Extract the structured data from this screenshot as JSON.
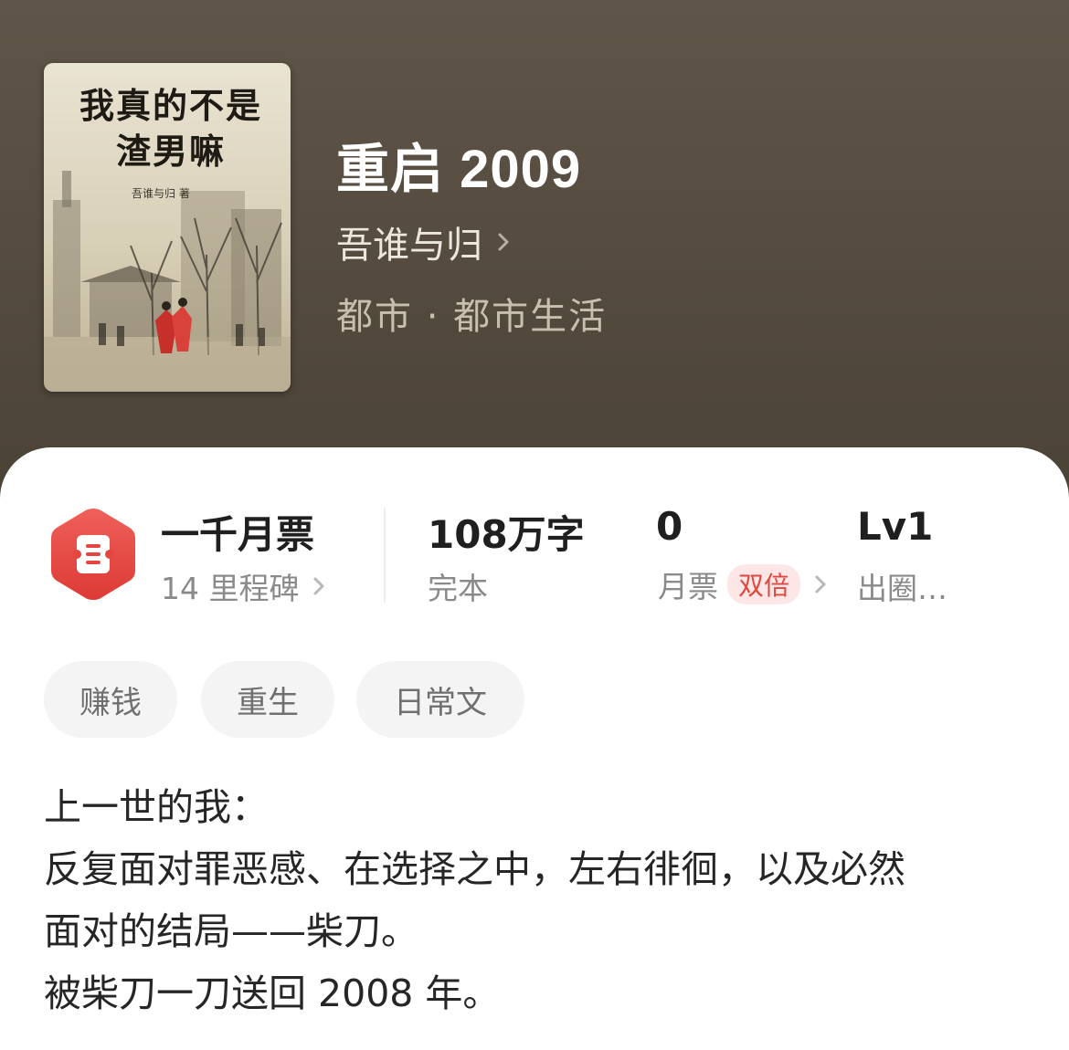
{
  "book": {
    "title": "重启 2009",
    "author": "吾谁与归",
    "genre": "都市 · 都市生活",
    "cover": {
      "title": "我真的不是\n渣男嘛",
      "author": "吾谁与归 著"
    }
  },
  "stats": {
    "monthly_tickets_milestone": {
      "label": "一千月票",
      "sub": "14 里程碑"
    },
    "word_count": {
      "value": "108万字",
      "status": "完本"
    },
    "monthly_ticket": {
      "value": "0",
      "label": "月票",
      "badge": "双倍"
    },
    "level": {
      "value": "Lv1",
      "label": "出圈…"
    }
  },
  "tags": [
    "赚钱",
    "重生",
    "日常文"
  ],
  "synopsis": [
    "上一世的我：",
    "反复面对罪恶感、在选择之中，左右徘徊，以及必然",
    "面对的结局——柴刀。",
    "被柴刀一刀送回 2008 年。"
  ],
  "colors": {
    "header_bg": "#564c40",
    "accent_red": "#e0473f"
  },
  "icons": {
    "badge": "ticket-hexagon-icon",
    "chevron": "chevron-right-icon"
  }
}
